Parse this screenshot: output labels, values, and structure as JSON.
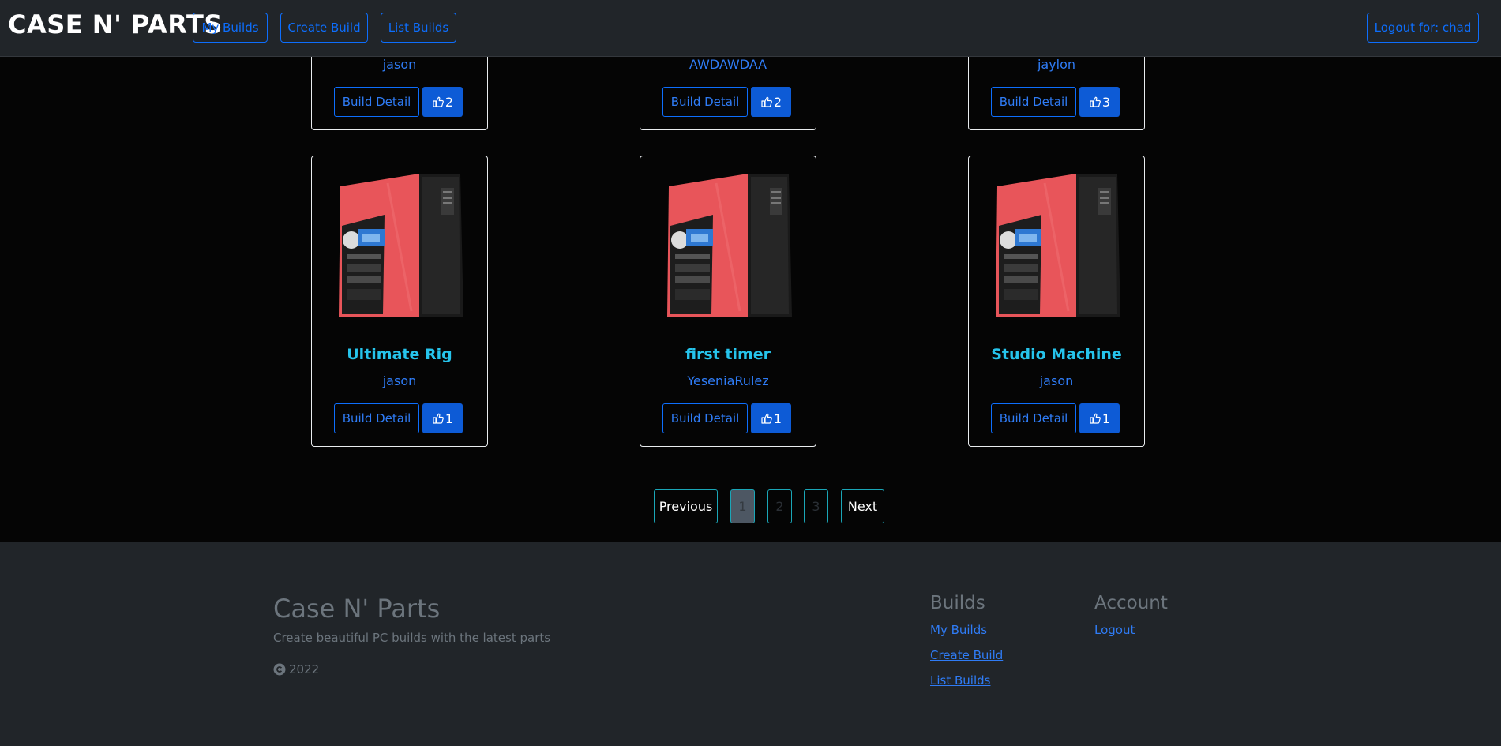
{
  "nav": {
    "brand": "CASE N' PARTS",
    "my_builds": "My Builds",
    "create_build": "Create Build",
    "list_builds": "List Builds",
    "logout": "Logout for: chad"
  },
  "top_row": [
    {
      "author": "jason",
      "detail_label": "Build Detail",
      "likes": "2"
    },
    {
      "author": "AWDAWDAA",
      "detail_label": "Build Detail",
      "likes": "2"
    },
    {
      "author": "jaylon",
      "detail_label": "Build Detail",
      "likes": "3"
    }
  ],
  "cards": [
    {
      "title": "Ultimate Rig",
      "author": "jason",
      "detail_label": "Build Detail",
      "likes": "1"
    },
    {
      "title": "first timer",
      "author": "YeseniaRulez",
      "detail_label": "Build Detail",
      "likes": "1"
    },
    {
      "title": "Studio Machine",
      "author": "jason",
      "detail_label": "Build Detail",
      "likes": "1"
    }
  ],
  "pagination": {
    "previous": "Previous",
    "pages": [
      "1",
      "2",
      "3"
    ],
    "active_page": "1",
    "next": "Next"
  },
  "footer": {
    "title": "Case N' Parts",
    "subtitle": "Create beautiful PC builds with the latest parts",
    "year": "2022",
    "builds_heading": "Builds",
    "builds_links": [
      "My Builds",
      "Create Build",
      "List Builds"
    ],
    "account_heading": "Account",
    "account_links": [
      "Logout"
    ]
  },
  "icons": {
    "like": "thumbs-up-icon",
    "copyright": "copyright-icon",
    "build_image": "pc-case-image"
  },
  "colors": {
    "accent": "#0d6efd",
    "title": "#26c4ec",
    "navbar": "#212529",
    "background": "#050505"
  }
}
